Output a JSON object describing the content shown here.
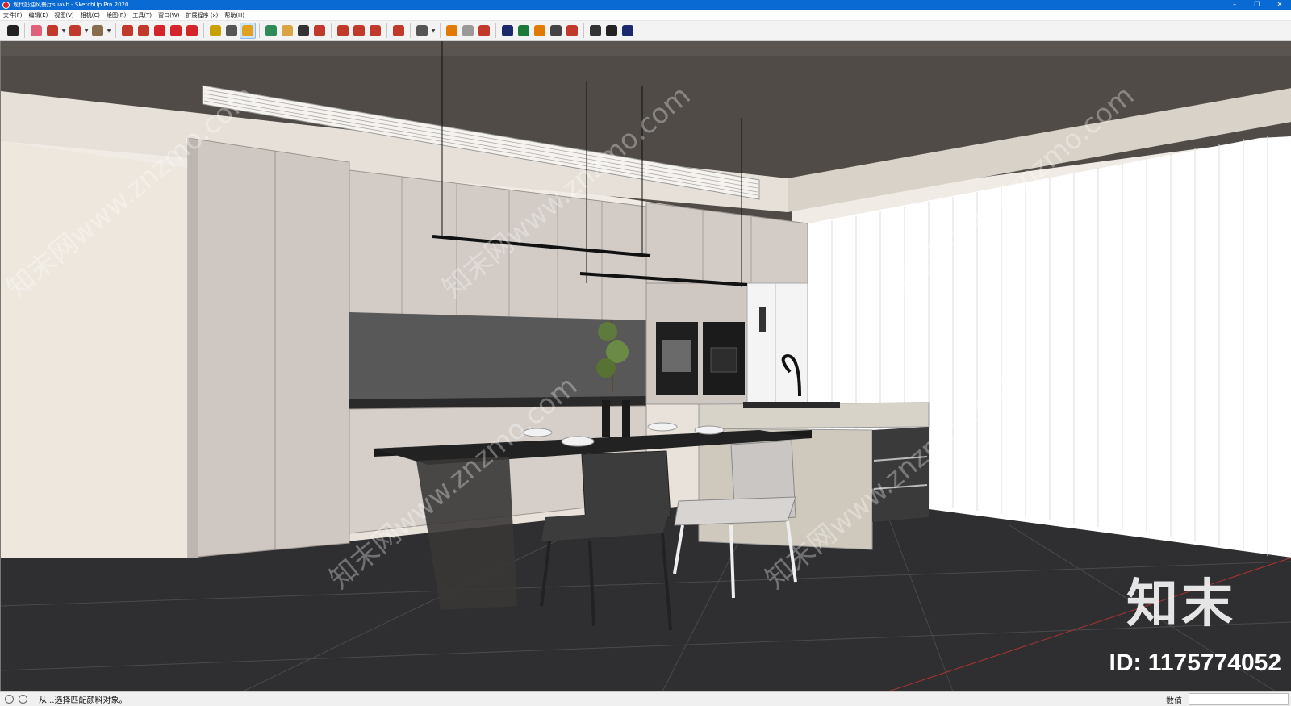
{
  "window": {
    "title": "现代奶油风餐厅suavb - SketchUp Pro 2020",
    "controls": {
      "minimize": "–",
      "maximize": "❐",
      "close": "✕"
    }
  },
  "menu": [
    "文件(F)",
    "编辑(E)",
    "视图(V)",
    "相机(C)",
    "绘图(R)",
    "工具(T)",
    "窗口(W)",
    "扩展程序 (x)",
    "帮助(H)"
  ],
  "toolbar": {
    "groups": [
      [
        {
          "name": "select-icon",
          "color": "#222222"
        }
      ],
      [
        {
          "name": "eraser-icon",
          "color": "#e0607a"
        },
        {
          "name": "pencil-icon",
          "color": "#c0392b",
          "dropdown": true
        },
        {
          "name": "arc-icon",
          "color": "#c0392b",
          "dropdown": true
        },
        {
          "name": "shape-icon",
          "color": "#8a6d4a",
          "dropdown": true
        }
      ],
      [
        {
          "name": "push-pull-icon",
          "color": "#c0392b"
        },
        {
          "name": "follow-me-icon",
          "color": "#c0392b"
        },
        {
          "name": "move-icon",
          "color": "#d4262a"
        },
        {
          "name": "rotate-icon",
          "color": "#d4262a"
        },
        {
          "name": "scale-icon",
          "color": "#d4262a"
        }
      ],
      [
        {
          "name": "tape-measure-icon",
          "color": "#c8a000"
        },
        {
          "name": "text-icon",
          "color": "#555555"
        },
        {
          "name": "paint-bucket-icon",
          "color": "#e0a020",
          "active": true
        }
      ],
      [
        {
          "name": "orbit-icon",
          "color": "#2e8b57"
        },
        {
          "name": "pan-icon",
          "color": "#d9a441"
        },
        {
          "name": "zoom-icon",
          "color": "#333333"
        },
        {
          "name": "zoom-extents-icon",
          "color": "#c0392b"
        }
      ],
      [
        {
          "name": "warehouse-icon",
          "color": "#c0392b"
        },
        {
          "name": "extension-warehouse-icon",
          "color": "#c0392b"
        },
        {
          "name": "layout-icon",
          "color": "#c0392b"
        }
      ],
      [
        {
          "name": "ruby-icon",
          "color": "#c0392b"
        }
      ],
      [
        {
          "name": "account-icon",
          "color": "#555555",
          "dropdown": true
        }
      ],
      [
        {
          "name": "plugin-a-icon",
          "color": "#e07b00"
        },
        {
          "name": "refresh-icon",
          "color": "#999999"
        },
        {
          "name": "layers-icon",
          "color": "#c0392b"
        }
      ],
      [
        {
          "name": "add-icon",
          "color": "#1a2a6c"
        },
        {
          "name": "tree-icon",
          "color": "#1a7a3a"
        },
        {
          "name": "stairs-icon",
          "color": "#e07b00"
        },
        {
          "name": "checker-icon",
          "color": "#444444"
        },
        {
          "name": "cloud-icon",
          "color": "#c0392b"
        }
      ],
      [
        {
          "name": "settings-icon",
          "color": "#333333"
        },
        {
          "name": "mail-icon",
          "color": "#222222"
        },
        {
          "name": "info-icon",
          "color": "#1a2a6c"
        }
      ]
    ]
  },
  "scene": {
    "watermark": "知末网www.znzmo.com",
    "brand": "知末",
    "id_text": "ID: 1175774052"
  },
  "status": {
    "text": "从...选择匹配颜料对象。",
    "measure_label": "数值"
  }
}
